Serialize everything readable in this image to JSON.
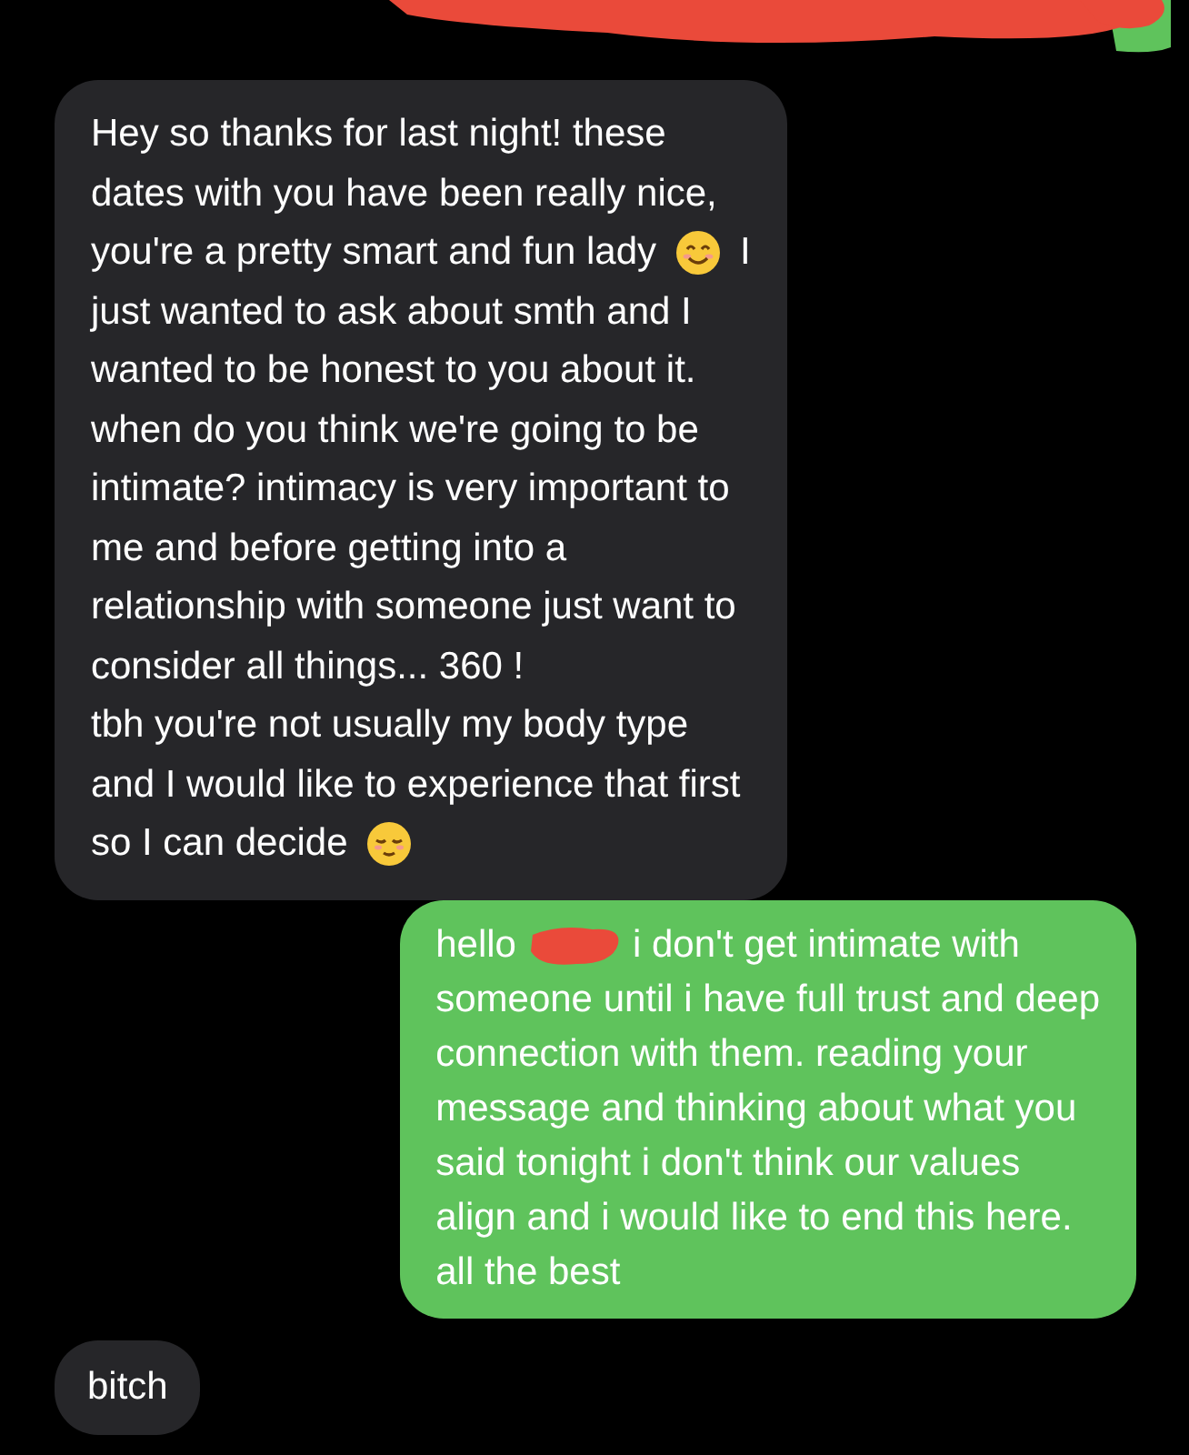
{
  "messages": [
    {
      "kind": "redacted"
    },
    {
      "kind": "incoming",
      "lines": [
        [
          {
            "kind": "text",
            "text": "Hey so thanks for last night! these"
          }
        ],
        [
          {
            "kind": "text",
            "text": "dates with you have been really nice,"
          }
        ],
        [
          {
            "kind": "text",
            "text": "you're a pretty smart and fun lady"
          },
          {
            "kind": "smile_emoji"
          },
          {
            "kind": "text",
            "text": "I"
          }
        ],
        [
          {
            "kind": "text",
            "text": "just wanted to ask about smth and I"
          }
        ],
        [
          {
            "kind": "text",
            "text": "wanted to be honest to you about it."
          }
        ],
        [
          {
            "kind": "text",
            "text": "when do you think we're going to be"
          }
        ],
        [
          {
            "kind": "text",
            "text": "intimate? intimacy is very important to"
          }
        ],
        [
          {
            "kind": "text",
            "text": "me and before getting into a"
          }
        ],
        [
          {
            "kind": "text",
            "text": "relationship with someone just want to"
          }
        ],
        [
          {
            "kind": "text",
            "text": "consider all things... 360 !"
          }
        ],
        [
          {
            "kind": "text",
            "text": "tbh you're not usually my body type"
          }
        ],
        [
          {
            "kind": "text",
            "text": "and I would like to experience that first"
          }
        ],
        [
          {
            "kind": "text",
            "text": "so I can decide"
          },
          {
            "kind": "relieved_emoji"
          }
        ]
      ]
    },
    {
      "kind": "outgoing",
      "lines": [
        [
          {
            "kind": "text",
            "text": "hello"
          },
          {
            "kind": "redaction"
          },
          {
            "kind": "text",
            "text": "i don't get intimate with"
          }
        ],
        [
          {
            "kind": "text",
            "text": "someone until i have full trust and deep"
          }
        ],
        [
          {
            "kind": "text",
            "text": "connection with them. reading your"
          }
        ],
        [
          {
            "kind": "text",
            "text": "message and thinking about what you"
          }
        ],
        [
          {
            "kind": "text",
            "text": "said tonight i don't think our values"
          }
        ],
        [
          {
            "kind": "text",
            "text": "align and i would like to end this here."
          }
        ],
        [
          {
            "kind": "text",
            "text": "all the best"
          }
        ]
      ]
    },
    {
      "kind": "incoming",
      "lines": [
        [
          {
            "kind": "text",
            "text": "bitch"
          }
        ]
      ]
    }
  ]
}
